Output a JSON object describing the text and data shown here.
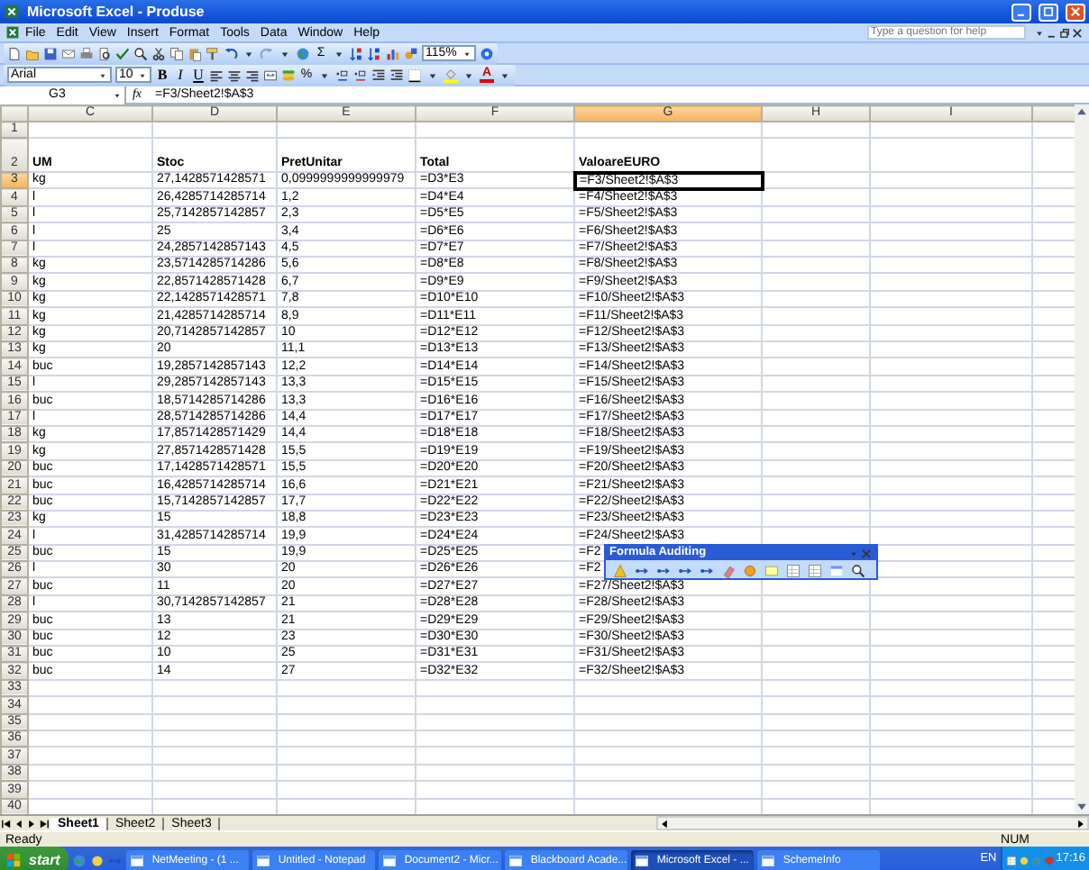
{
  "window": {
    "title": "Microsoft Excel - Produse"
  },
  "menu": [
    "File",
    "Edit",
    "View",
    "Insert",
    "Format",
    "Tools",
    "Data",
    "Window",
    "Help"
  ],
  "help_placeholder": "Type a question for help",
  "standard_toolbar": {
    "sum": "Σ",
    "zoom": "115%"
  },
  "formatting_toolbar": {
    "font": "Arial",
    "size": "10",
    "styles": [
      "B",
      "I",
      "U"
    ],
    "percent": "%",
    "font_color": "A"
  },
  "formula_bar": {
    "cell": "G3",
    "fx": "fx",
    "formula": "=F3/Sheet2!$A$3"
  },
  "columns": [
    {
      "label": "C",
      "selected": false
    },
    {
      "label": "D",
      "selected": false
    },
    {
      "label": "E",
      "selected": false
    },
    {
      "label": "F",
      "selected": false
    },
    {
      "label": "G",
      "selected": true
    },
    {
      "label": "H",
      "selected": false
    },
    {
      "label": "I",
      "selected": false
    }
  ],
  "rows": [
    {
      "n": "1",
      "selected": false
    },
    {
      "n": "2",
      "selected": false,
      "bold": true,
      "cells": [
        "UM",
        "Stoc",
        "PretUnitar",
        "Total",
        "ValoareEURO"
      ]
    },
    {
      "n": "3",
      "selected": true,
      "bold": false,
      "cells": [
        "kg",
        "27,1428571428571",
        "0,0999999999999979",
        "=D3*E3",
        "=F3/Sheet2!$A$3"
      ]
    },
    {
      "n": "4",
      "selected": false,
      "bold": false,
      "cells": [
        "l",
        "26,4285714285714",
        "1,2",
        "=D4*E4",
        "=F4/Sheet2!$A$3"
      ]
    },
    {
      "n": "5",
      "selected": false,
      "bold": false,
      "cells": [
        "l",
        "25,7142857142857",
        "2,3",
        "=D5*E5",
        "=F5/Sheet2!$A$3"
      ]
    },
    {
      "n": "6",
      "selected": false,
      "bold": false,
      "cells": [
        "l",
        "25",
        "3,4",
        "=D6*E6",
        "=F6/Sheet2!$A$3"
      ]
    },
    {
      "n": "7",
      "selected": false,
      "bold": false,
      "cells": [
        "l",
        "24,2857142857143",
        "4,5",
        "=D7*E7",
        "=F7/Sheet2!$A$3"
      ]
    },
    {
      "n": "8",
      "selected": false,
      "bold": false,
      "cells": [
        "kg",
        "23,5714285714286",
        "5,6",
        "=D8*E8",
        "=F8/Sheet2!$A$3"
      ]
    },
    {
      "n": "9",
      "selected": false,
      "bold": false,
      "cells": [
        "kg",
        "22,8571428571428",
        "6,7",
        "=D9*E9",
        "=F9/Sheet2!$A$3"
      ]
    },
    {
      "n": "10",
      "selected": false,
      "bold": false,
      "cells": [
        "kg",
        "22,1428571428571",
        "7,8",
        "=D10*E10",
        "=F10/Sheet2!$A$3"
      ]
    },
    {
      "n": "11",
      "selected": false,
      "bold": false,
      "cells": [
        "kg",
        "21,4285714285714",
        "8,9",
        "=D11*E11",
        "=F11/Sheet2!$A$3"
      ]
    },
    {
      "n": "12",
      "selected": false,
      "bold": false,
      "cells": [
        "kg",
        "20,7142857142857",
        "10",
        "=D12*E12",
        "=F12/Sheet2!$A$3"
      ]
    },
    {
      "n": "13",
      "selected": false,
      "bold": false,
      "cells": [
        "kg",
        "20",
        "11,1",
        "=D13*E13",
        "=F13/Sheet2!$A$3"
      ]
    },
    {
      "n": "14",
      "selected": false,
      "bold": false,
      "cells": [
        "buc",
        "19,2857142857143",
        "12,2",
        "=D14*E14",
        "=F14/Sheet2!$A$3"
      ]
    },
    {
      "n": "15",
      "selected": false,
      "bold": false,
      "cells": [
        "l",
        "29,2857142857143",
        "13,3",
        "=D15*E15",
        "=F15/Sheet2!$A$3"
      ]
    },
    {
      "n": "16",
      "selected": false,
      "bold": false,
      "cells": [
        "buc",
        "18,5714285714286",
        "13,3",
        "=D16*E16",
        "=F16/Sheet2!$A$3"
      ]
    },
    {
      "n": "17",
      "selected": false,
      "bold": false,
      "cells": [
        "l",
        "28,5714285714286",
        "14,4",
        "=D17*E17",
        "=F17/Sheet2!$A$3"
      ]
    },
    {
      "n": "18",
      "selected": false,
      "bold": false,
      "cells": [
        "kg",
        "17,8571428571429",
        "14,4",
        "=D18*E18",
        "=F18/Sheet2!$A$3"
      ]
    },
    {
      "n": "19",
      "selected": false,
      "bold": false,
      "cells": [
        "kg",
        "27,8571428571428",
        "15,5",
        "=D19*E19",
        "=F19/Sheet2!$A$3"
      ]
    },
    {
      "n": "20",
      "selected": false,
      "bold": false,
      "cells": [
        "buc",
        "17,1428571428571",
        "15,5",
        "=D20*E20",
        "=F20/Sheet2!$A$3"
      ]
    },
    {
      "n": "21",
      "selected": false,
      "bold": false,
      "cells": [
        "buc",
        "16,4285714285714",
        "16,6",
        "=D21*E21",
        "=F21/Sheet2!$A$3"
      ]
    },
    {
      "n": "22",
      "selected": false,
      "bold": false,
      "cells": [
        "buc",
        "15,7142857142857",
        "17,7",
        "=D22*E22",
        "=F22/Sheet2!$A$3"
      ]
    },
    {
      "n": "23",
      "selected": false,
      "bold": false,
      "cells": [
        "kg",
        "15",
        "18,8",
        "=D23*E23",
        "=F23/Sheet2!$A$3"
      ]
    },
    {
      "n": "24",
      "selected": false,
      "bold": false,
      "cells": [
        "l",
        "31,4285714285714",
        "19,9",
        "=D24*E24",
        "=F24/Sheet2!$A$3"
      ]
    },
    {
      "n": "25",
      "selected": false,
      "bold": false,
      "cells": [
        "buc",
        "15",
        "19,9",
        "=D25*E25",
        "=F2"
      ]
    },
    {
      "n": "26",
      "selected": false,
      "bold": false,
      "cells": [
        "l",
        "30",
        "20",
        "=D26*E26",
        "=F2"
      ]
    },
    {
      "n": "27",
      "selected": false,
      "bold": false,
      "cells": [
        "buc",
        "11",
        "20",
        "=D27*E27",
        "=F27/Sheet2!$A$3"
      ]
    },
    {
      "n": "28",
      "selected": false,
      "bold": false,
      "cells": [
        "l",
        "30,7142857142857",
        "21",
        "=D28*E28",
        "=F28/Sheet2!$A$3"
      ]
    },
    {
      "n": "29",
      "selected": false,
      "bold": false,
      "cells": [
        "buc",
        "13",
        "21",
        "=D29*E29",
        "=F29/Sheet2!$A$3"
      ]
    },
    {
      "n": "30",
      "selected": false,
      "bold": false,
      "cells": [
        "buc",
        "12",
        "23",
        "=D30*E30",
        "=F30/Sheet2!$A$3"
      ]
    },
    {
      "n": "31",
      "selected": false,
      "bold": false,
      "cells": [
        "buc",
        "10",
        "25",
        "=D31*E31",
        "=F31/Sheet2!$A$3"
      ]
    },
    {
      "n": "32",
      "selected": false,
      "bold": false,
      "cells": [
        "buc",
        "14",
        "27",
        "=D32*E32",
        "=F32/Sheet2!$A$3"
      ]
    },
    {
      "n": "33",
      "selected": false
    },
    {
      "n": "34",
      "selected": false
    },
    {
      "n": "35",
      "selected": false
    },
    {
      "n": "36",
      "selected": false
    },
    {
      "n": "37",
      "selected": false
    },
    {
      "n": "38",
      "selected": false
    },
    {
      "n": "39",
      "selected": false
    },
    {
      "n": "40",
      "selected": false
    }
  ],
  "auditing_toolbar": {
    "title": "Formula Auditing"
  },
  "sheet_tabs": [
    {
      "label": "Sheet1",
      "selected": true
    },
    {
      "label": "Sheet2",
      "selected": false
    },
    {
      "label": "Sheet3",
      "selected": false
    }
  ],
  "status_bar": {
    "left": "Ready",
    "right": "NUM"
  },
  "taskbar": {
    "start": "start",
    "tasks": [
      {
        "label": "NetMeeting - (1 ...",
        "selected": false
      },
      {
        "label": "Untitled - Notepad",
        "selected": false
      },
      {
        "label": "Document2 - Micr...",
        "selected": false
      },
      {
        "label": "Blackboard Acade...",
        "selected": false
      },
      {
        "label": "Microsoft Excel - ...",
        "selected": true
      },
      {
        "label": "SchemeInfo",
        "selected": false
      }
    ],
    "language": "EN",
    "clock": "17:16"
  }
}
